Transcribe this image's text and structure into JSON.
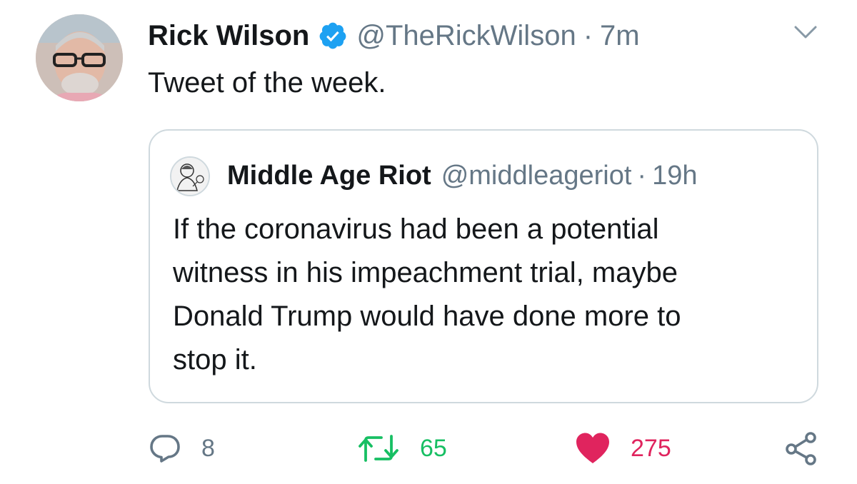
{
  "tweet": {
    "author_name": "Rick Wilson",
    "handle": "@TheRickWilson",
    "separator": "·",
    "time": "7m",
    "text": "Tweet of the week."
  },
  "quoted_tweet": {
    "author_name": "Middle Age Riot",
    "handle": "@middleageriot",
    "separator": "·",
    "time": "19h",
    "text_lines": [
      "If the coronavirus had been a potential",
      "witness in his impeachment trial, maybe",
      "Donald Trump would have done more to",
      "stop it."
    ]
  },
  "actions": {
    "reply": {
      "icon": "reply-icon",
      "count": "8"
    },
    "retweet": {
      "icon": "retweet-icon",
      "count": "65"
    },
    "like": {
      "icon": "heart-icon",
      "count": "275",
      "liked": true
    },
    "share": {
      "icon": "share-icon"
    }
  },
  "colors": {
    "text": "#14171a",
    "secondary": "#657786",
    "verified": "#1da1f2",
    "retweet": "#17bf63",
    "like": "#e0245e",
    "quote_border": "#cfd9de"
  }
}
